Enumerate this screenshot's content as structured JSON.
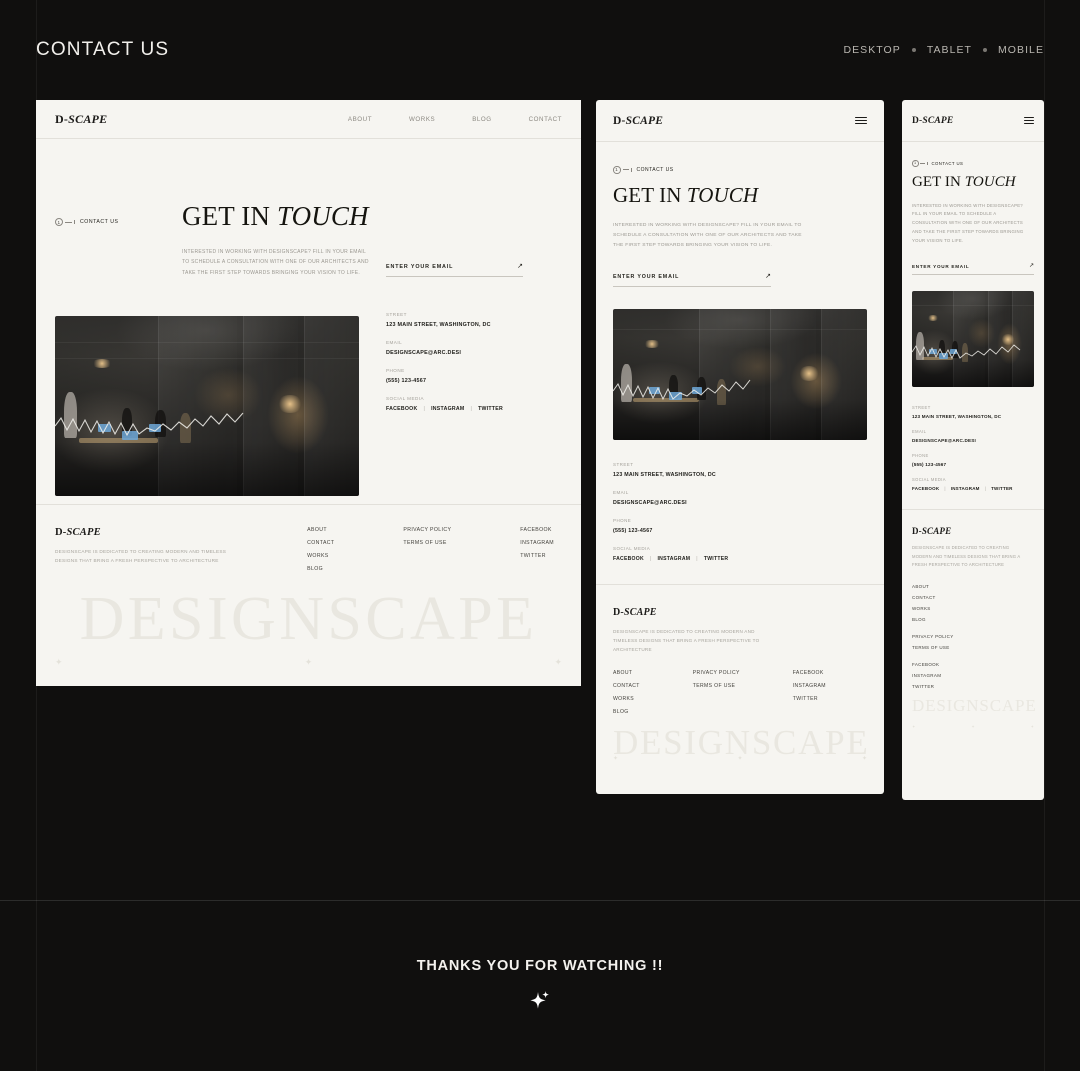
{
  "topbar": {
    "title": "CONTACT US",
    "devices": [
      "DESKTOP",
      "TABLET",
      "MOBILE"
    ]
  },
  "brand": {
    "logo_prefix": "D-",
    "logo_suffix": "SCAPE",
    "watermark": "DESIGNSCAPE"
  },
  "nav": {
    "items": [
      "ABOUT",
      "WORKS",
      "BLOG",
      "CONTACT"
    ]
  },
  "hero": {
    "eyebrow_number": "1",
    "eyebrow_label": "CONTACT US",
    "headline_regular": "GET IN ",
    "headline_italic": "TOUCH",
    "lede_desktop": "INTERESTED IN WORKING WITH DESIGNSCAPE? FILL IN YOUR EMAIL TO SCHEDULE A CONSULTATION WITH ONE OF OUR ARCHITECTS AND TAKE THE FIRST STEP TOWARDS BRINGING YOUR VISION TO LIFE.",
    "email_placeholder": "ENTER YOUR EMAIL",
    "email_value": "",
    "submit_icon": "arrow-up-right-icon"
  },
  "contact": {
    "fields": [
      {
        "label": "STREET",
        "value": "123 MAIN STREET, WASHINGTON, DC"
      },
      {
        "label": "EMAIL",
        "value": "DESIGNSCAPE@ARC.DESI"
      },
      {
        "label": "PHONE",
        "value": "(555) 123-4567"
      }
    ],
    "social_label": "SOCIAL MEDIA",
    "social_links": [
      "FACEBOOK",
      "INSTAGRAM",
      "TWITTER"
    ],
    "social_separator": "|"
  },
  "footer": {
    "tagline": "DESIGNSCAPE IS DEDICATED TO CREATING MODERN AND TIMELESS DESIGNS THAT BRING A FRESH PERSPECTIVE TO ARCHITECTURE",
    "columns": [
      {
        "links": [
          "ABOUT",
          "CONTACT",
          "WORKS",
          "BLOG"
        ]
      },
      {
        "links": [
          "PRIVACY POLICY",
          "TERMS OF USE"
        ]
      },
      {
        "links": [
          "FACEBOOK",
          "INSTAGRAM",
          "TWITTER"
        ]
      }
    ],
    "sparkle_icon": "sparkle-icon"
  },
  "bottom": {
    "thanks_text": "THANKS YOU FOR WATCHING !!",
    "sparkle_icon": "sparkle-icon"
  },
  "colors": {
    "page_background": "#100f0e",
    "mockup_background": "#f6f5f1",
    "text_dark": "#1c1b19",
    "text_muted": "#9b9891",
    "watermark": "#e9e7e0"
  },
  "menu_icon": "hamburger-menu-icon"
}
